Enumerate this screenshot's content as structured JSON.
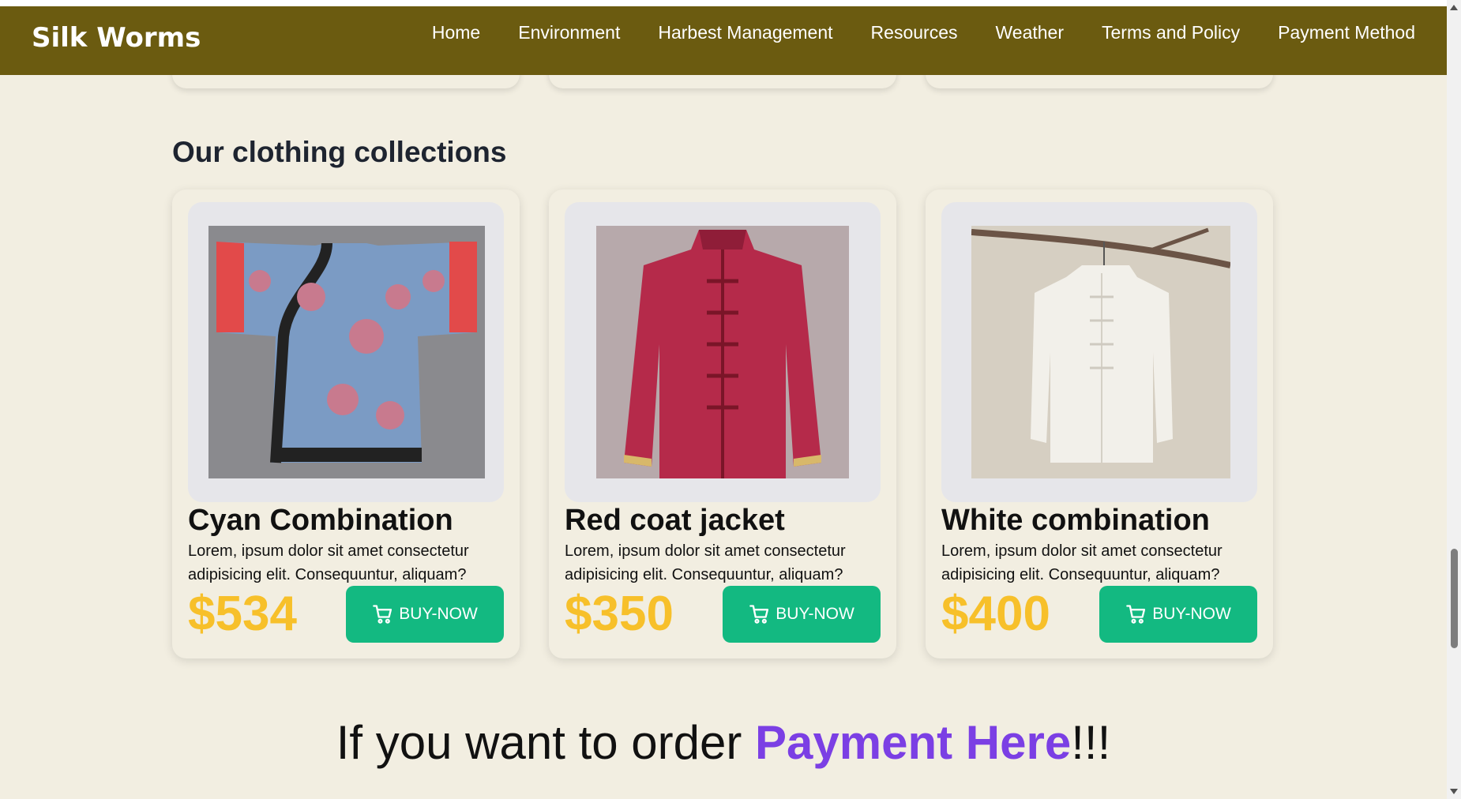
{
  "nav": {
    "brand": "Silk Worms",
    "links": [
      "Home",
      "Environment",
      "Harbest Management",
      "Resources",
      "Weather",
      "Terms and Policy",
      "Payment Method"
    ]
  },
  "section": {
    "title": "Our clothing collections"
  },
  "products": [
    {
      "name": "Cyan Combination",
      "description": "Lorem, ipsum dolor sit amet consectetur adipisicing elit. Consequuntur, aliquam?",
      "price": "$534",
      "button": "BUY-NOW"
    },
    {
      "name": "Red coat jacket",
      "description": "Lorem, ipsum dolor sit amet consectetur adipisicing elit. Consequuntur, aliquam?",
      "price": "$350",
      "button": "BUY-NOW"
    },
    {
      "name": "White combination",
      "description": "Lorem, ipsum dolor sit amet consectetur adipisicing elit. Consequuntur, aliquam?",
      "price": "$400",
      "button": "BUY-NOW"
    }
  ],
  "order": {
    "prefix": "If you want to order ",
    "link": "Payment Here",
    "suffix": "!!!"
  },
  "colors": {
    "navbar": "#6b5b10",
    "page_background": "#f2eee1",
    "price": "#f7c02a",
    "button": "#13b981",
    "link": "#7b3fe4"
  },
  "icons": {
    "buy_button": "cart-icon"
  }
}
